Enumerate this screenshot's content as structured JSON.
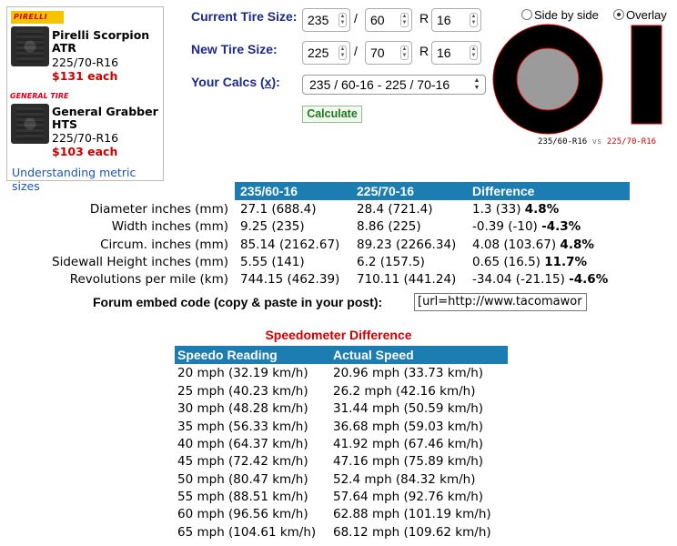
{
  "ads": {
    "brand1_logo": "PIRELLI",
    "brand1_product": "Pirelli Scorpion ATR",
    "brand1_size": "225/70-R16",
    "brand1_price": "$131 each",
    "brand2_logo": "GENERAL TIRE",
    "brand2_product": "General Grabber HTS",
    "brand2_size": "225/70-R16",
    "brand2_price": "$103 each",
    "link": "Understanding metric sizes"
  },
  "form": {
    "current_label": "Current Tire Size:",
    "new_label": "New Tire Size:",
    "calcs_label_prefix": "Your Calcs (",
    "calcs_label_link": "x",
    "calcs_label_suffix": "):",
    "separator_slash": "/",
    "separator_r": "R",
    "current": {
      "width": "235",
      "aspect": "60",
      "rim": "16"
    },
    "new": {
      "width": "225",
      "aspect": "70",
      "rim": "16"
    },
    "calcs_selected": "235 / 60-16 - 225 / 70-16",
    "calculate_label": "Calculate"
  },
  "visual": {
    "mode_side": "Side by side",
    "mode_overlay": "Overlay",
    "selected_mode": "overlay",
    "caption_current": "235/60-R16",
    "caption_vs": "vs",
    "caption_new": "225/70-R16"
  },
  "comparison": {
    "headers": [
      "235/60-16",
      "225/70-16",
      "Difference"
    ],
    "rows": [
      {
        "label": "Diameter inches (mm)",
        "current": "27.1 (688.4)",
        "new": "28.4 (721.4)",
        "diff": "1.3 (33)",
        "pct": "4.8%"
      },
      {
        "label": "Width inches (mm)",
        "current": "9.25 (235)",
        "new": "8.86 (225)",
        "diff": "-0.39 (-10)",
        "pct": "-4.3%"
      },
      {
        "label": "Circum. inches (mm)",
        "current": "85.14 (2162.67)",
        "new": "89.23 (2266.34)",
        "diff": "4.08 (103.67)",
        "pct": "4.8%"
      },
      {
        "label": "Sidewall Height inches (mm)",
        "current": "5.55 (141)",
        "new": "6.2 (157.5)",
        "diff": "0.65 (16.5)",
        "pct": "11.7%"
      },
      {
        "label": "Revolutions per mile (km)",
        "current": "744.15 (462.39)",
        "new": "710.11 (441.24)",
        "diff": "-34.04 (-21.15)",
        "pct": "-4.6%"
      }
    ]
  },
  "embed": {
    "label": "Forum embed code (copy & paste in your post):",
    "value": "[url=http://www.tacomawor"
  },
  "speedo": {
    "title": "Speedometer Difference",
    "headers": [
      "Speedo Reading",
      "Actual Speed"
    ],
    "rows": [
      {
        "reading": "20 mph (32.19 km/h)",
        "actual": "20.96 mph (33.73 km/h)"
      },
      {
        "reading": "25 mph (40.23 km/h)",
        "actual": "26.2 mph (42.16 km/h)"
      },
      {
        "reading": "30 mph (48.28 km/h)",
        "actual": "31.44 mph (50.59 km/h)"
      },
      {
        "reading": "35 mph (56.33 km/h)",
        "actual": "36.68 mph (59.03 km/h)"
      },
      {
        "reading": "40 mph (64.37 km/h)",
        "actual": "41.92 mph (67.46 km/h)"
      },
      {
        "reading": "45 mph (72.42 km/h)",
        "actual": "47.16 mph (75.89 km/h)"
      },
      {
        "reading": "50 mph (80.47 km/h)",
        "actual": "52.4 mph (84.32 km/h)"
      },
      {
        "reading": "55 mph (88.51 km/h)",
        "actual": "57.64 mph (92.76 km/h)"
      },
      {
        "reading": "60 mph (96.56 km/h)",
        "actual": "62.88 mph (101.19 km/h)"
      },
      {
        "reading": "65 mph (104.61 km/h)",
        "actual": "68.12 mph (109.62 km/h)"
      }
    ]
  },
  "colors": {
    "header_blue": "#1c7db2",
    "label_navy": "#1b2a8a",
    "price_red": "#d10000",
    "button_green": "#1c7a1c"
  }
}
